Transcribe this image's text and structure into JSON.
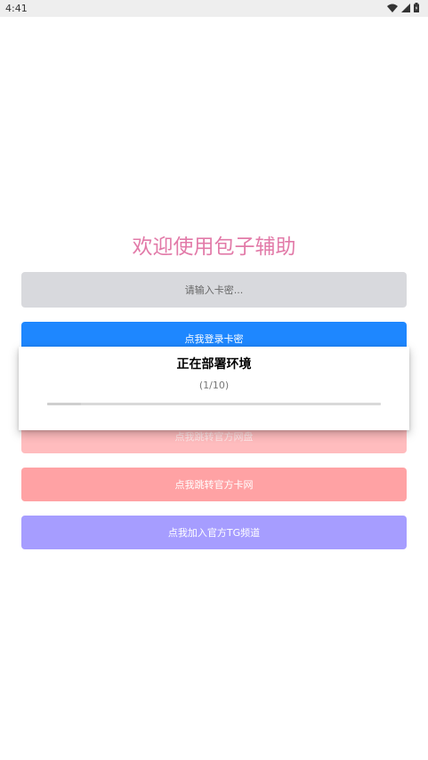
{
  "status_bar": {
    "time": "4:41",
    "icons": [
      "wifi-icon",
      "signal-icon",
      "battery-icon"
    ]
  },
  "main": {
    "title": "欢迎使用包子辅助",
    "card_input": {
      "placeholder": "请输入卡密...",
      "value": ""
    },
    "login_button": "点我登录卡密",
    "pan_button": "点我跳转官方网盘",
    "card_site_button": "点我跳转官方卡网",
    "tg_button": "点我加入官方TG频道"
  },
  "dialog": {
    "title": "正在部署环境",
    "progress_text": "(1/10)",
    "progress": {
      "current": 1,
      "total": 10
    }
  },
  "colors": {
    "title": "#e27aa8",
    "login_button": "#1e87ff",
    "card_site_button": "#ffa2a4",
    "tg_button": "#a69dff"
  }
}
